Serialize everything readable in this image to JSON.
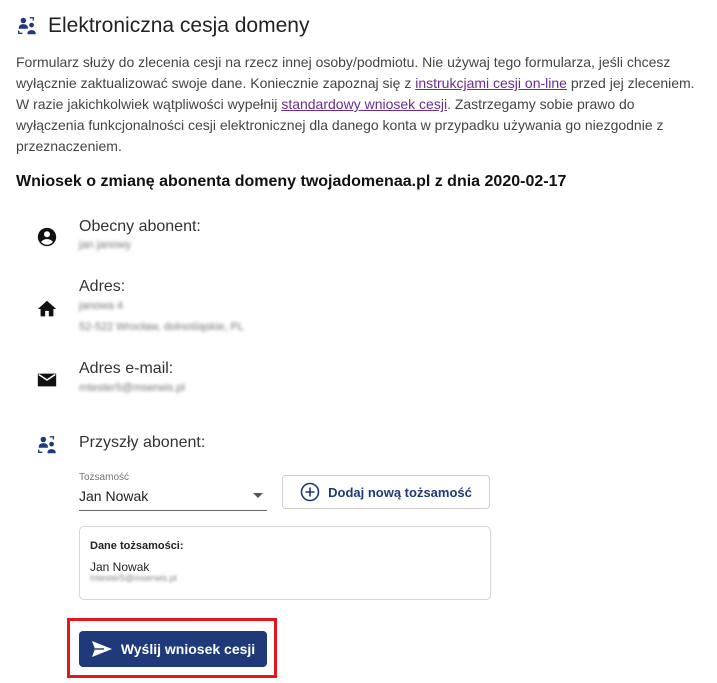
{
  "header": {
    "title": "Elektroniczna cesja domeny"
  },
  "intro": {
    "part1": "Formularz służy do zlecenia cesji na rzecz innej osoby/podmiotu. Nie używaj tego formularza, jeśli chcesz wyłącznie zaktualizować swoje dane. Koniecznie zapoznaj się z ",
    "link1": "instrukcjami cesji on-line",
    "part2": " przed jej zleceniem. W razie jakichkolwiek wątpliwości wypełnij ",
    "link2": "standardowy wniosek cesji",
    "part3": ". Zastrzegamy sobie prawo do wyłączenia funkcjonalności cesji elektronicznej dla danego konta w przypadku używania go niezgodnie z przeznaczeniem."
  },
  "request": {
    "title": "Wniosek o zmianę abonenta domeny twojadomenaa.pl z dnia 2020-02-17"
  },
  "current_subscriber": {
    "label": "Obecny abonent:",
    "value": "jan janowy"
  },
  "address": {
    "label": "Adres:",
    "line1": "janowa 4",
    "line2": "52-522 Wrocław, dolnośląskie, PL"
  },
  "email": {
    "label": "Adres e-mail:",
    "value": "mtester5@mserwis.pl"
  },
  "future_subscriber": {
    "label": "Przyszły abonent:"
  },
  "identity_select": {
    "label": "Tożsamość",
    "value": "Jan Nowak"
  },
  "add_identity_button": {
    "label": "Dodaj nową tożsamość"
  },
  "identity_card": {
    "title": "Dane tożsamości:",
    "name": "Jan Nowak",
    "email": "mtester5@mserwis.pl"
  },
  "send_button": {
    "label": "Wyślij wniosek cesji"
  },
  "colors": {
    "primary": "#1f3a7a",
    "link": "#6b2c91",
    "highlight": "#e4161c"
  }
}
